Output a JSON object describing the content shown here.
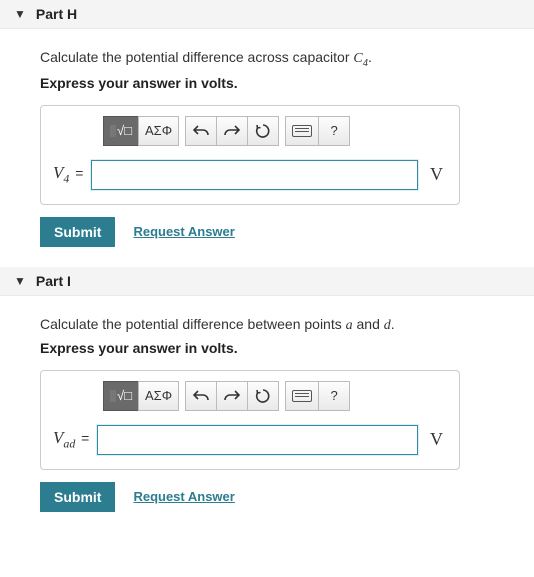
{
  "parts": [
    {
      "id": "H",
      "title": "Part H",
      "prompt_pre": "Calculate the potential difference across capacitor ",
      "prompt_var": "C",
      "prompt_sub": "4",
      "prompt_post": ".",
      "instruction": "Express your answer in volts.",
      "var_letter": "V",
      "var_sub": "4",
      "unit": "V",
      "value": ""
    },
    {
      "id": "I",
      "title": "Part I",
      "prompt_pre": "Calculate the potential difference between points ",
      "prompt_var": "a",
      "prompt_mid": " and ",
      "prompt_var2": "d",
      "prompt_post": ".",
      "instruction": "Express your answer in volts.",
      "var_letter": "V",
      "var_sub": "ad",
      "unit": "V",
      "value": ""
    }
  ],
  "toolbar": {
    "greek_label": "ΑΣΦ",
    "help_label": "?"
  },
  "buttons": {
    "submit": "Submit",
    "request": "Request Answer"
  }
}
